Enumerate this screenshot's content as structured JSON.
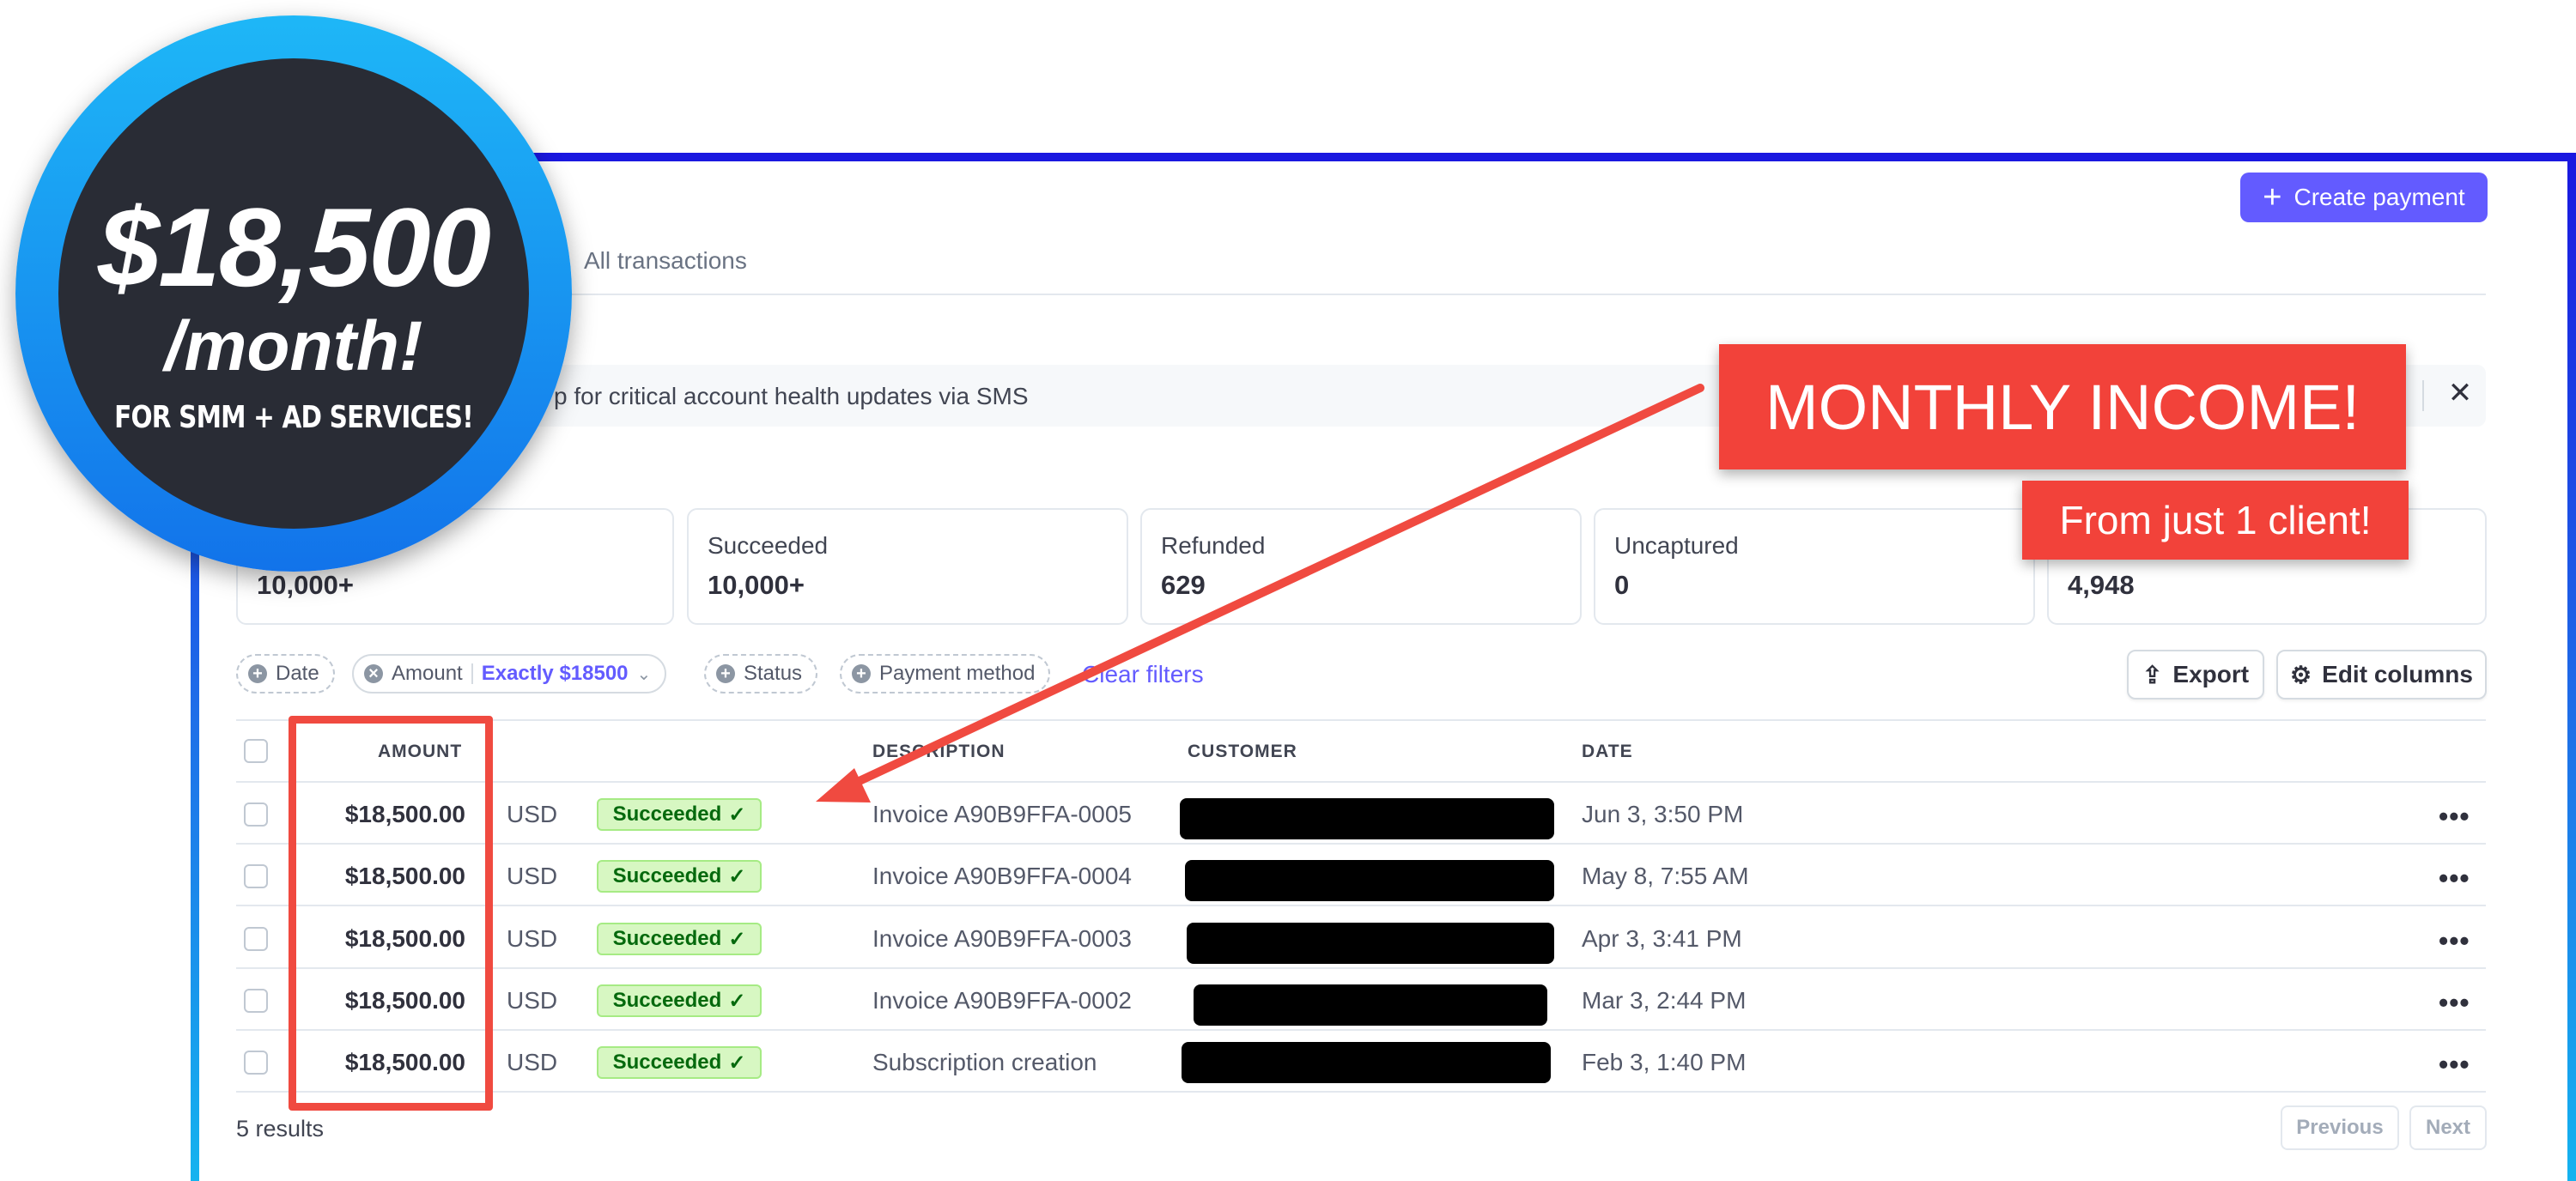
{
  "header": {
    "create_payment": "Create payment"
  },
  "tabs": {
    "all_transactions": "All transactions"
  },
  "banner": {
    "text": "p for critical account health updates via SMS",
    "close": "✕"
  },
  "stats": [
    {
      "label": "",
      "value": "10,000+"
    },
    {
      "label": "Succeeded",
      "value": "10,000+"
    },
    {
      "label": "Refunded",
      "value": "629"
    },
    {
      "label": "Uncaptured",
      "value": "0"
    },
    {
      "label": "",
      "value": "4,948"
    }
  ],
  "filters": {
    "date": "Date",
    "amount": "Amount",
    "amount_value": "Exactly $18500",
    "status": "Status",
    "payment_method": "Payment method",
    "clear": "Clear filters"
  },
  "toolbar": {
    "export": "Export",
    "edit_columns": "Edit columns"
  },
  "table": {
    "headers": {
      "amount": "AMOUNT",
      "description": "DESCRIPTION",
      "customer": "CUSTOMER",
      "date": "DATE"
    },
    "rows": [
      {
        "amount": "$18,500.00",
        "currency": "USD",
        "status": "Succeeded",
        "description": "Invoice A90B9FFA-0005",
        "date": "Jun 3, 3:50 PM"
      },
      {
        "amount": "$18,500.00",
        "currency": "USD",
        "status": "Succeeded",
        "description": "Invoice A90B9FFA-0004",
        "date": "May 8, 7:55 AM"
      },
      {
        "amount": "$18,500.00",
        "currency": "USD",
        "status": "Succeeded",
        "description": "Invoice A90B9FFA-0003",
        "date": "Apr 3, 3:41 PM"
      },
      {
        "amount": "$18,500.00",
        "currency": "USD",
        "status": "Succeeded",
        "description": "Invoice A90B9FFA-0002",
        "date": "Mar 3, 2:44 PM"
      },
      {
        "amount": "$18,500.00",
        "currency": "USD",
        "status": "Succeeded",
        "description": "Subscription creation",
        "date": "Feb 3, 1:40 PM"
      }
    ],
    "more": "•••"
  },
  "footer": {
    "results": "5 results",
    "previous": "Previous",
    "next": "Next"
  },
  "overlay": {
    "price": "$18,500",
    "per": "/month!",
    "note": "FOR SMM + AD SERVICES!",
    "callout_main": "MONTHLY INCOME!",
    "callout_sub": "From just 1 client!"
  },
  "colors": {
    "accent": "#635bff",
    "success_bg": "#d7f7c2",
    "success_text": "#05690d",
    "annotation_red": "#f2423a"
  }
}
